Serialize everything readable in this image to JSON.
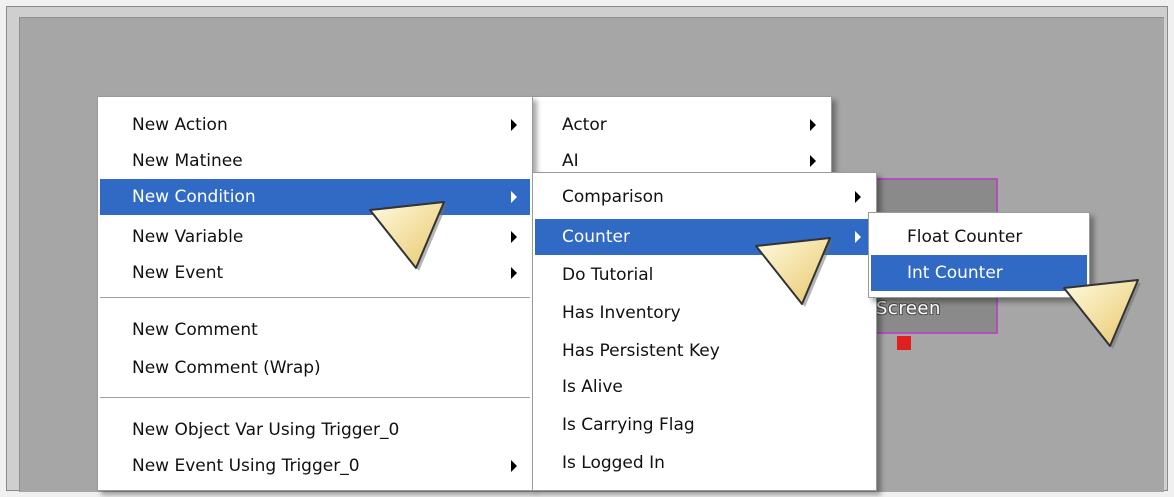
{
  "menu": {
    "main": [
      {
        "label": "New Action",
        "has_submenu": true
      },
      {
        "label": "New Matinee",
        "has_submenu": false
      },
      {
        "label": "New Condition",
        "has_submenu": true,
        "highlighted": true
      },
      {
        "label": "New Variable",
        "has_submenu": true
      },
      {
        "label": "New Event",
        "has_submenu": true
      },
      {
        "label": "New Comment",
        "has_submenu": false
      },
      {
        "label": "New Comment (Wrap)",
        "has_submenu": false
      },
      {
        "label": "New Object Var Using Trigger_0",
        "has_submenu": false
      },
      {
        "label": "New Event Using Trigger_0",
        "has_submenu": true
      }
    ],
    "action_sub": [
      {
        "label": "Actor",
        "has_submenu": true
      },
      {
        "label": "AI",
        "has_submenu": true
      }
    ],
    "condition_sub": [
      {
        "label": "Comparison",
        "has_submenu": true
      },
      {
        "label": "Counter",
        "has_submenu": true,
        "highlighted": true
      },
      {
        "label": "Do Tutorial",
        "has_submenu": false
      },
      {
        "label": "Has Inventory",
        "has_submenu": false
      },
      {
        "label": "Has Persistent Key",
        "has_submenu": false
      },
      {
        "label": "Is Alive",
        "has_submenu": false
      },
      {
        "label": "Is Carrying Flag",
        "has_submenu": false
      },
      {
        "label": "Is Logged In",
        "has_submenu": false
      }
    ],
    "counter_sub": [
      {
        "label": "Float Counter",
        "has_submenu": false
      },
      {
        "label": "Int Counter",
        "has_submenu": false,
        "highlighted": true
      }
    ]
  },
  "node": {
    "label": "Screen"
  },
  "colors": {
    "highlight": "#316ac5",
    "canvas": "#a6a6a6",
    "node_border": "#b24fbf",
    "port": "#e02020"
  }
}
